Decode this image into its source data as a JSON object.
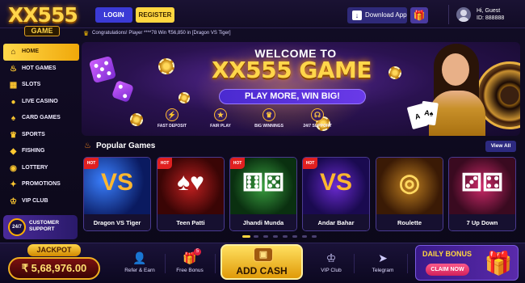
{
  "header": {
    "logo_main": "XX555",
    "logo_sub": "GAME",
    "login_label": "LOGIN",
    "register_label": "REGISTER",
    "download_label": "Download App",
    "greeting": "Hi, Guest",
    "user_id": "ID: 888888"
  },
  "ticker": {
    "text": "Congratulations! Player ****78 Win ₹56,850 in [Dragon VS Tiger]"
  },
  "sidebar": {
    "items": [
      {
        "label": "HOME",
        "icon": "home-icon",
        "glyph": "⌂"
      },
      {
        "label": "HOT GAMES",
        "icon": "fire-icon",
        "glyph": "♨"
      },
      {
        "label": "SLOTS",
        "icon": "slots-icon",
        "glyph": "▦"
      },
      {
        "label": "LIVE CASINO",
        "icon": "person-icon",
        "glyph": "●"
      },
      {
        "label": "CARD GAMES",
        "icon": "cards-icon",
        "glyph": "♠"
      },
      {
        "label": "SPORTS",
        "icon": "trophy-icon",
        "glyph": "♛"
      },
      {
        "label": "FISHING",
        "icon": "fish-icon",
        "glyph": "◆"
      },
      {
        "label": "LOTTERY",
        "icon": "lottery-icon",
        "glyph": "◉"
      },
      {
        "label": "PROMOTIONS",
        "icon": "gift-icon",
        "glyph": "✦"
      },
      {
        "label": "VIP CLUB",
        "icon": "crown-icon",
        "glyph": "♔"
      }
    ],
    "support_line1": "CUSTOMER",
    "support_line2": "SUPPORT",
    "support_badge": "24/7"
  },
  "banner": {
    "welcome": "WELCOME TO",
    "title": "XX555 GAME",
    "subtitle": "PLAY MORE, WIN BIG!",
    "features": [
      {
        "label": "FAST DEPOSIT",
        "icon": "lightning-icon",
        "glyph": "⚡"
      },
      {
        "label": "FAIR PLAY",
        "icon": "shield-icon",
        "glyph": "★"
      },
      {
        "label": "BIG WINNINGS",
        "icon": "trophy-icon",
        "glyph": "♛"
      },
      {
        "label": "24/7 SUPPORT",
        "icon": "headset-icon",
        "glyph": "☊"
      }
    ]
  },
  "popular": {
    "title": "Popular Games",
    "view_all": "View All",
    "games": [
      {
        "label": "Dragon VS Tiger",
        "hot": "HOT",
        "glyph": "VS"
      },
      {
        "label": "Teen Patti",
        "hot": "HOT",
        "glyph": "♠♥"
      },
      {
        "label": "Jhandi Munda",
        "hot": "HOT",
        "glyph": "⚅⚄"
      },
      {
        "label": "Andar Bahar",
        "hot": "HOT",
        "glyph": "VS"
      },
      {
        "label": "Roulette",
        "hot": "",
        "glyph": "◎"
      },
      {
        "label": "7 Up Down",
        "hot": "",
        "glyph": "⚂⚃"
      }
    ]
  },
  "bottom": {
    "jackpot_label": "JACKPOT",
    "jackpot_value": "₹ 5,68,976.00",
    "tabs": [
      {
        "label": "Refer & Earn",
        "icon": "refer-icon",
        "glyph": "👤"
      },
      {
        "label": "Free Bonus",
        "icon": "gift-icon",
        "glyph": "🎁",
        "badge": "5"
      },
      {
        "label": "VIP Club",
        "icon": "crown-icon",
        "glyph": "♔"
      },
      {
        "label": "Telegram",
        "icon": "telegram-icon",
        "glyph": "➤"
      }
    ],
    "add_cash": "ADD CASH",
    "daily_bonus": "DAILY BONUS",
    "claim_now": "CLAIM NOW"
  },
  "colors": {
    "accent": "#ffd640",
    "brand_blue": "#3b3ad6",
    "background": "#120c26"
  }
}
